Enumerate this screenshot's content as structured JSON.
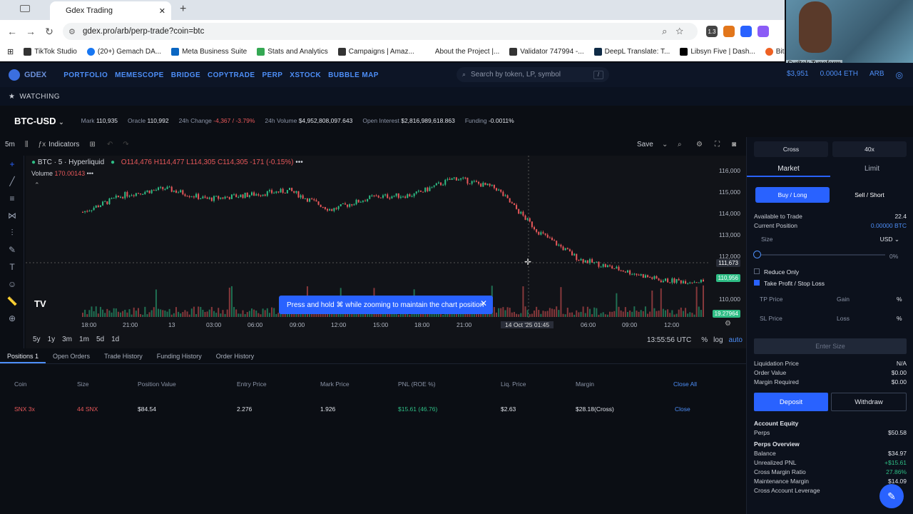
{
  "browser": {
    "tab_title": "Gdex Trading",
    "url": "gdex.pro/arb/perp-trade?coin=btc",
    "bookmarks": [
      "TikTok Studio",
      "(20+) Gemach DA...",
      "Meta Business Suite",
      "Stats and Analytics",
      "Campaigns | Amaz...",
      "About the Project |...",
      "Validator 747994 -...",
      "DeepL Translate: T...",
      "Libsyn Five | Dash...",
      "Bitly | Links"
    ],
    "ext_badge": "1.3"
  },
  "webcam": {
    "name": "Sydtek Typeform"
  },
  "app": {
    "logo": "GDEX",
    "nav": [
      "PORTFOLIO",
      "MEMESCOPE",
      "BRIDGE",
      "COPYTRADE",
      "PERP",
      "XSTOCK",
      "BUBBLE MAP"
    ],
    "search_placeholder": "Search by token, LP, symbol",
    "search_kbd": "/",
    "wallet_usd": "$3,951",
    "wallet_eth": "0.0004 ETH",
    "network": "ARB",
    "watching": "WATCHING"
  },
  "ticker": {
    "pair": "BTC-USD",
    "mark_label": "Mark",
    "mark": "110,935",
    "oracle_label": "Oracle",
    "oracle": "110,992",
    "change_label": "24h Change",
    "change": "-4,367 / -3.79%",
    "volume_label": "24h Volume",
    "volume": "$4,952,808,097.643",
    "oi_label": "Open Interest",
    "oi": "$2,816,989,618.863",
    "funding_label": "Funding",
    "funding": "-0.0011%"
  },
  "toolbar": {
    "interval": "5m",
    "indicators": "Indicators",
    "save": "Save"
  },
  "chart": {
    "symbol": "BTC · 5 · Hyperliquid",
    "o": "O114,476",
    "h": "H114,477",
    "l": "L114,305",
    "c": "C114,305",
    "chg": "-171 (-0.15%)",
    "volume_label": "Volume",
    "volume_value": "170.00143",
    "yticks": [
      "116,000",
      "115,000",
      "114,000",
      "113,000",
      "112,000",
      "110,000"
    ],
    "xticks": [
      "18:00",
      "21:00",
      "13",
      "03:00",
      "06:00",
      "09:00",
      "12:00",
      "15:00",
      "18:00",
      "21:00",
      "06:00",
      "09:00",
      "12:00"
    ],
    "crosshair_x": "14 Oct '25   01:45",
    "crosshair_price": "111,673",
    "last_price": "110,956",
    "volume_tag": "19.27964",
    "toast": "Press and hold ⌘ while zooming to maintain the chart position",
    "ranges": [
      "5y",
      "1y",
      "3m",
      "1m",
      "5d",
      "1d"
    ],
    "clock": "13:55:56 UTC",
    "pct": "%",
    "log": "log",
    "auto": "auto",
    "colors": {
      "up": "#2ebd85",
      "down": "#e8585a",
      "accent": "#2962ff"
    }
  },
  "chart_data": {
    "type": "line",
    "title": "",
    "xlabel": "",
    "ylabel": "",
    "ylim": [
      109500,
      116500
    ],
    "x": [
      "12 Oct 18:00",
      "12 Oct 21:00",
      "13 Oct 00:00",
      "13 Oct 03:00",
      "13 Oct 06:00",
      "13 Oct 09:00",
      "13 Oct 12:00",
      "13 Oct 15:00",
      "13 Oct 18:00",
      "13 Oct 21:00",
      "14 Oct 00:00",
      "14 Oct 03:00",
      "14 Oct 06:00",
      "14 Oct 09:00",
      "14 Oct 12:00",
      "14 Oct 13:55"
    ],
    "series": [
      {
        "values": [
          114200,
          115000,
          115300,
          114800,
          115000,
          115200,
          114300,
          114900,
          115000,
          115800,
          115300,
          113300,
          112000,
          111500,
          111000,
          110956
        ]
      }
    ]
  },
  "positions": {
    "tabs": [
      "Positions 1",
      "Open Orders",
      "Trade History",
      "Funding History",
      "Order History"
    ],
    "headers": [
      "Coin",
      "Size",
      "Position Value",
      "Entry Price",
      "Mark Price",
      "PNL (ROE %)",
      "Liq. Price",
      "Margin",
      "Close All"
    ],
    "rows": [
      {
        "coin": "SNX 3x",
        "size": "44 SNX",
        "value": "$84.54",
        "entry": "2.276",
        "mark": "1.926",
        "pnl": "$15.61 (46.76)",
        "liq": "$2.63",
        "margin": "$28.18(Cross)",
        "close": "Close"
      }
    ]
  },
  "order": {
    "cross": "Cross",
    "leverage": "40x",
    "tab_market": "Market",
    "tab_limit": "Limit",
    "buy": "Buy / Long",
    "sell": "Sell / Short",
    "available_label": "Available to Trade",
    "available": "22.4",
    "position_label": "Current Position",
    "position": "0.00000 BTC",
    "size_label": "Size",
    "size_unit": "USD ⌄",
    "slider_pct": "0%",
    "slider_value": 0,
    "reduce_only": "Reduce Only",
    "tpsl": "Take Profit / Stop Loss",
    "tp_label": "TP Price",
    "gain": "Gain",
    "sl_label": "SL Price",
    "loss": "Loss",
    "pct": "%",
    "enter": "Enter Size",
    "liq_label": "Liquidation Price",
    "liq": "N/A",
    "order_value_label": "Order Value",
    "order_value": "$0.00",
    "margin_label": "Margin Required",
    "margin": "$0.00",
    "deposit": "Deposit",
    "withdraw": "Withdraw",
    "equity_title": "Account Equity",
    "perps_label": "Perps",
    "perps": "$50.58",
    "overview_title": "Perps Overview",
    "balance_label": "Balance",
    "balance": "$34.97",
    "upnl_label": "Unrealized PNL",
    "upnl": "+$15.61",
    "cmr_label": "Cross Margin Ratio",
    "cmr": "27.86%",
    "mm_label": "Maintenance Margin",
    "mm": "$14.09",
    "lev_label": "Cross Account Leverage"
  }
}
